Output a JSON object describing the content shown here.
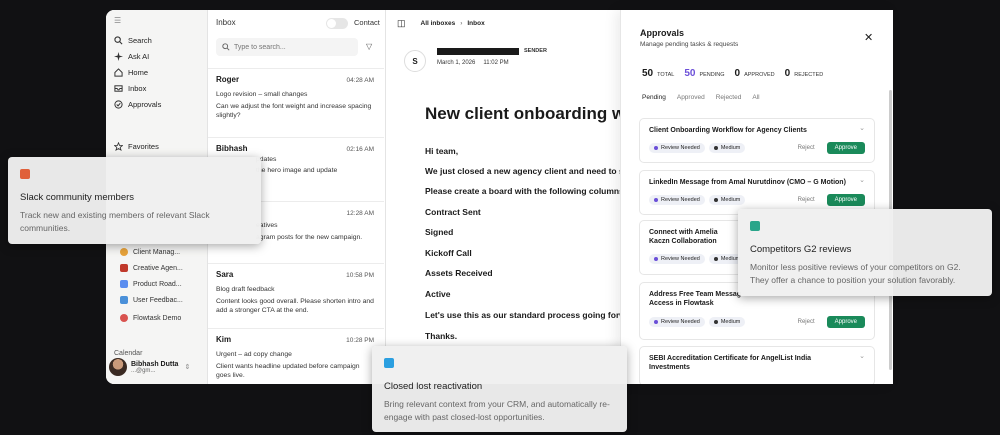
{
  "sidebar": {
    "nav": [
      {
        "label": "Search",
        "icon": "search-icon"
      },
      {
        "label": "Ask AI",
        "icon": "sparkle-icon"
      },
      {
        "label": "Home",
        "icon": "home-icon"
      },
      {
        "label": "Inbox",
        "icon": "inbox-icon"
      },
      {
        "label": "Approvals",
        "icon": "check-circle-icon"
      }
    ],
    "favorites_label": "Favorites",
    "workspaces": [
      {
        "label": "Client Manag...",
        "color": "#e8a33b"
      },
      {
        "label": "Creative Agen...",
        "color": "#c0392b"
      },
      {
        "label": "Product Road...",
        "color": "#5b8def"
      },
      {
        "label": "User Feedbac...",
        "color": "#4a90d9"
      },
      {
        "label": "Flowtask Demo",
        "color": "#d9534f"
      }
    ],
    "calendar_label": "Calendar",
    "user": {
      "name": "Bibhash Dutta",
      "email": "...@gm..."
    }
  },
  "inbox": {
    "title": "Inbox",
    "contact_label": "Contact",
    "search_placeholder": "Type to search...",
    "messages": [
      {
        "name": "Roger",
        "time": "04:28 AM",
        "subject": "Logo revision – small changes",
        "body": "Can we adjust the font weight and increase spacing slightly?"
      },
      {
        "name": "Bibhash",
        "time": "02:16 AM",
        "subject": "pdates",
        "body": "the hero image and update"
      },
      {
        "name": "",
        "time": "12:28 AM",
        "subject": "eatives",
        "body": "agram posts for the new campaign."
      },
      {
        "name": "Sara",
        "time": "10:58 PM",
        "subject": "Blog draft feedback",
        "body": "Content looks good overall. Please shorten intro and add a stronger CTA at the end."
      },
      {
        "name": "Kim",
        "time": "10:28 PM",
        "subject": "Urgent – ad copy change",
        "body": "Client wants headline updated before campaign goes live."
      }
    ]
  },
  "main": {
    "breadcrumb": [
      "All inboxes",
      "Inbox"
    ],
    "sender_initial": "S",
    "sender_tag": "SENDER",
    "date": "March 1, 2026",
    "time": "11:02 PM",
    "subject": "New client onboarding wo",
    "lines": [
      "Hi team,",
      "We just closed a new agency client and need to set u",
      "Please create a board with the following columns:",
      "Contract Sent",
      "Signed",
      "Kickoff Call",
      "Assets Received",
      "Active",
      "Let's use this as our standard process going forward",
      "Thanks."
    ]
  },
  "approvals": {
    "title": "Approvals",
    "subtitle": "Manage pending tasks & requests",
    "stats": [
      {
        "n": "50",
        "label": "TOTAL",
        "color": "#111111"
      },
      {
        "n": "50",
        "label": "PENDING",
        "color": "#6b4fd8"
      },
      {
        "n": "0",
        "label": "APPROVED",
        "color": "#111111"
      },
      {
        "n": "0",
        "label": "REJECTED",
        "color": "#111111"
      }
    ],
    "tabs": [
      "Pending",
      "Approved",
      "Rejected",
      "All"
    ],
    "pill_review": "Review Needed",
    "pill_medium": "Medium",
    "reject": "Reject",
    "approve": "Approve",
    "cards": [
      {
        "title": "Client Onboarding Workflow for Agency Clients"
      },
      {
        "title": "LinkedIn Message from Amal Nurutdinov (CMO – G Motion)"
      },
      {
        "title": "Connect with Amelia Kaczn Collaboration"
      },
      {
        "title": "Address Free Team Messag Access in Flowtask"
      },
      {
        "title": "SEBI Accreditation Certificate for AngelList India Investments"
      }
    ]
  },
  "callouts": [
    {
      "title": "Slack community members",
      "desc": "Track new and existing members of relevant Slack communities.",
      "color": "#e0603a"
    },
    {
      "title": "Competitors G2 reviews",
      "desc": "Monitor less positive reviews of your competitors on G2. They offer a chance to position your solution favorably.",
      "color": "#2aa58a"
    },
    {
      "title": "Closed lost reactivation",
      "desc": "Bring relevant context from your CRM, and automatically re-engage with past closed-lost opportunities.",
      "color": "#2b9fe0"
    }
  ]
}
